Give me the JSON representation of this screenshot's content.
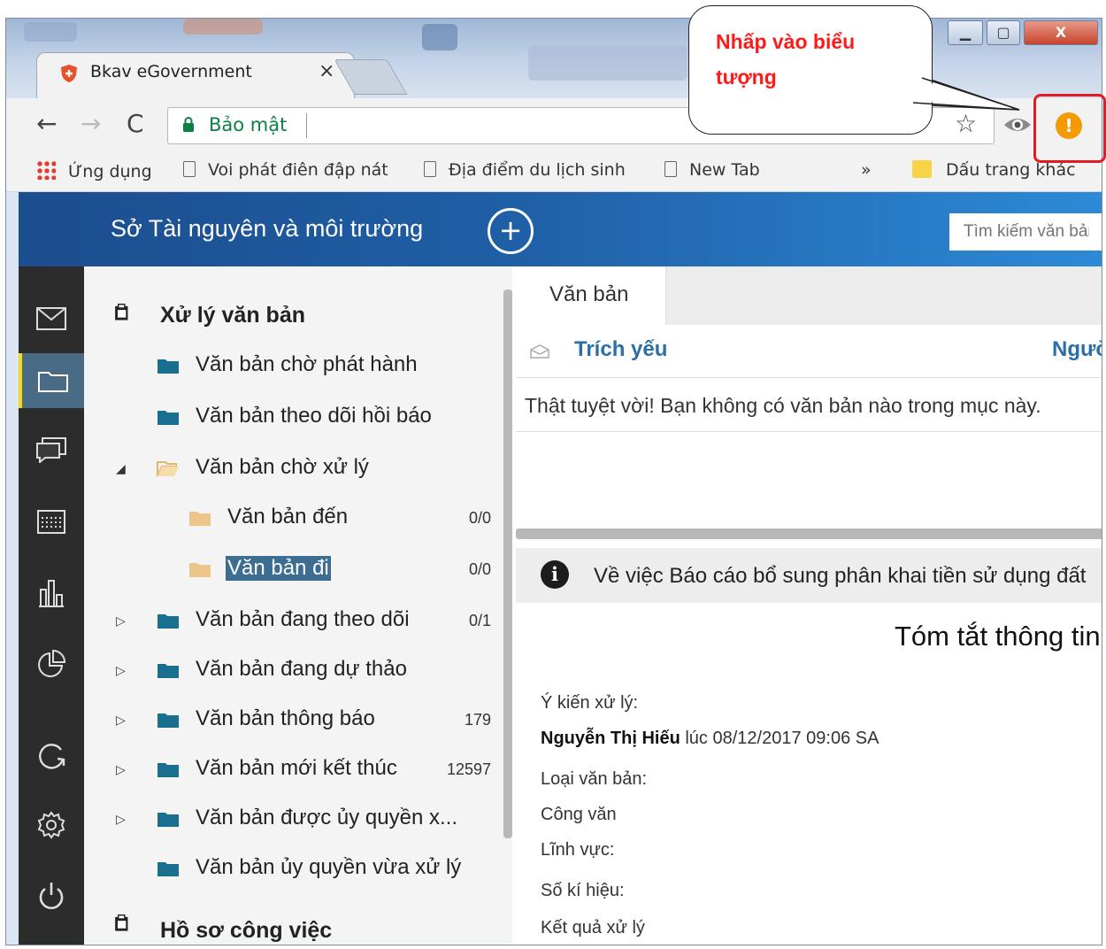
{
  "browser": {
    "tab_title": "Bkav eGovernment",
    "tab_close": "×",
    "security_label": "Bảo mật",
    "bookmarks": [
      {
        "label": "Ứng dụng",
        "icon": "apps-icon"
      },
      {
        "label": "Voi phát điên đập nát",
        "icon": "page-icon"
      },
      {
        "label": "Địa điểm du lịch sinh",
        "icon": "page-icon"
      },
      {
        "label": "New Tab",
        "icon": "page-icon"
      }
    ],
    "bookmarks_more": "»",
    "other_bookmarks": "Dấu trang khác",
    "window_controls": {
      "minimize": "▁",
      "maximize": "▢",
      "close": "X"
    }
  },
  "callout": {
    "text": "Nhấp vào biểu tượng"
  },
  "app": {
    "brand": "Sở Tài nguyên và môi trường",
    "add_label": "+",
    "search_placeholder": "Tìm kiếm văn bản"
  },
  "rail": [
    {
      "name": "mail-icon",
      "active": false
    },
    {
      "name": "folder-icon",
      "active": true
    },
    {
      "name": "chat-icon",
      "active": false
    },
    {
      "name": "calendar-icon",
      "active": false
    },
    {
      "name": "bar-chart-icon",
      "active": false
    },
    {
      "name": "pie-chart-icon",
      "active": false
    },
    {
      "name": "refresh-icon",
      "active": false
    },
    {
      "name": "gear-icon",
      "active": false
    },
    {
      "name": "power-icon",
      "active": false
    }
  ],
  "tree": {
    "section_title": "Xử lý văn bản",
    "items": [
      {
        "label": "Văn bản chờ phát hành",
        "count": "",
        "toggle": ""
      },
      {
        "label": "Văn bản theo dõi hồi báo",
        "count": "",
        "toggle": ""
      },
      {
        "label": "Văn bản chờ xử lý",
        "count": "",
        "toggle": "◢"
      },
      {
        "label": "Văn bản đến",
        "count": "0/0",
        "toggle": ""
      },
      {
        "label": "Văn bản đi",
        "count": "0/0",
        "toggle": ""
      },
      {
        "label": "Văn bản đang theo dõi",
        "count": "0/1",
        "toggle": "▷"
      },
      {
        "label": "Văn bản đang dự thảo",
        "count": "",
        "toggle": "▷"
      },
      {
        "label": "Văn bản thông báo",
        "count": "179",
        "toggle": "▷"
      },
      {
        "label": "Văn bản mới kết thúc",
        "count": "12597",
        "toggle": "▷"
      },
      {
        "label": "Văn bản được ủy quyền x...",
        "count": "",
        "toggle": "▷"
      },
      {
        "label": "Văn bản ủy quyền vừa xử lý",
        "count": "",
        "toggle": ""
      }
    ],
    "section2_title": "Hồ sơ công việc"
  },
  "main": {
    "tab_label": "Văn bản",
    "col_summary": "Trích yếu",
    "col_person": "Người",
    "empty_message": "Thật tuyệt vời! Bạn không có văn bản nào trong mục này.",
    "info_text": "Về việc Báo cáo bổ sung phân khai tiền sử dụng đất",
    "summary_title": "Tóm tắt thông tin",
    "opinion_label": "Ý kiến xử lý:",
    "opinion_author": "Nguyễn Thị Hiếu",
    "opinion_time": "lúc 08/12/2017 09:06 SA",
    "doc_type_label": "Loại văn bản:",
    "doc_type_value": "Công văn",
    "field_label": "Lĩnh vực:",
    "symbol_label": "Số kí hiệu:",
    "result_label": "Kết quả xử lý"
  }
}
